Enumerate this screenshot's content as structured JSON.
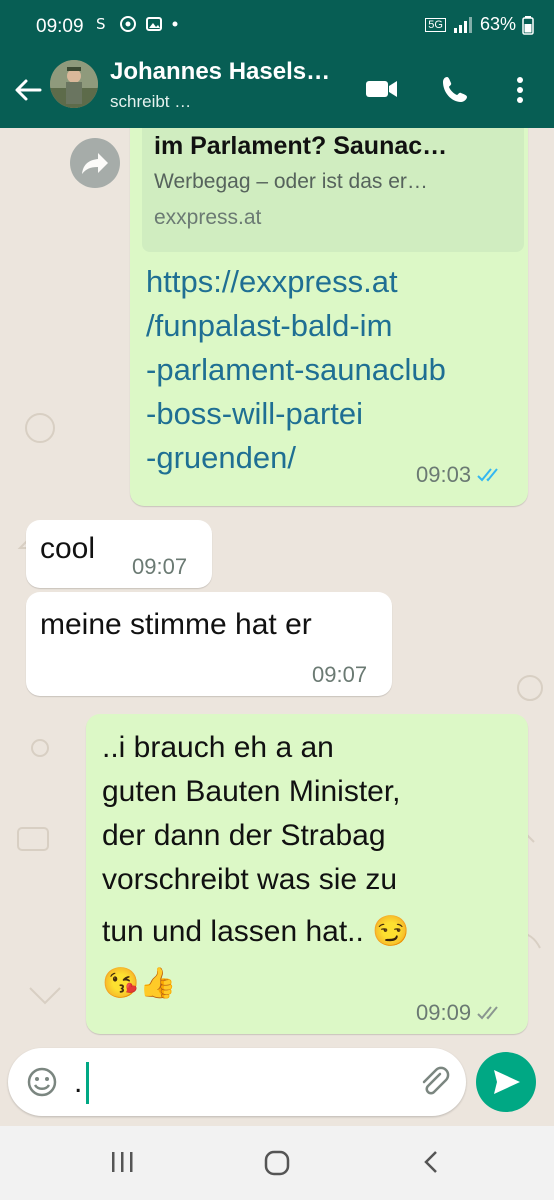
{
  "status_bar": {
    "time": "09:09",
    "network": "5G",
    "battery": "63%"
  },
  "header": {
    "contact_name": "Johannes Hasels…",
    "status": "schreibt …"
  },
  "messages": [
    {
      "direction": "outgoing",
      "preview": {
        "title": "im Parlament? Saunac…",
        "description": "Werbegag – oder ist das er…",
        "domain": "exxpress.at"
      },
      "link_lines": [
        "https://exxpress.at",
        "/funpalast-bald-im",
        "-parlament-saunaclub",
        "-boss-will-partei",
        "-gruenden/"
      ],
      "time": "09:03",
      "read": true
    },
    {
      "direction": "incoming",
      "text": "cool",
      "time": "09:07"
    },
    {
      "direction": "incoming",
      "text": "meine stimme hat er",
      "time": "09:07"
    },
    {
      "direction": "outgoing",
      "lines": [
        "..i brauch eh a an",
        "guten Bauten Minister,",
        "der dann der Strabag",
        "vorschreibt was sie zu",
        "tun und lassen hat.. 😏",
        "😘👍"
      ],
      "time": "09:09",
      "read": false
    }
  ],
  "composer": {
    "value": "."
  },
  "colors": {
    "header": "#075e54",
    "outgoing": "#dcf8c6",
    "incoming": "#ffffff",
    "send": "#00a884",
    "link": "#1f6f93",
    "read_ticks": "#34b7f1"
  },
  "icons": [
    "back-arrow-icon",
    "video-call-icon",
    "phone-icon",
    "more-vert-icon",
    "forward-icon",
    "emoji-icon",
    "attach-icon",
    "send-icon",
    "recents-icon",
    "home-icon",
    "back-nav-icon"
  ]
}
